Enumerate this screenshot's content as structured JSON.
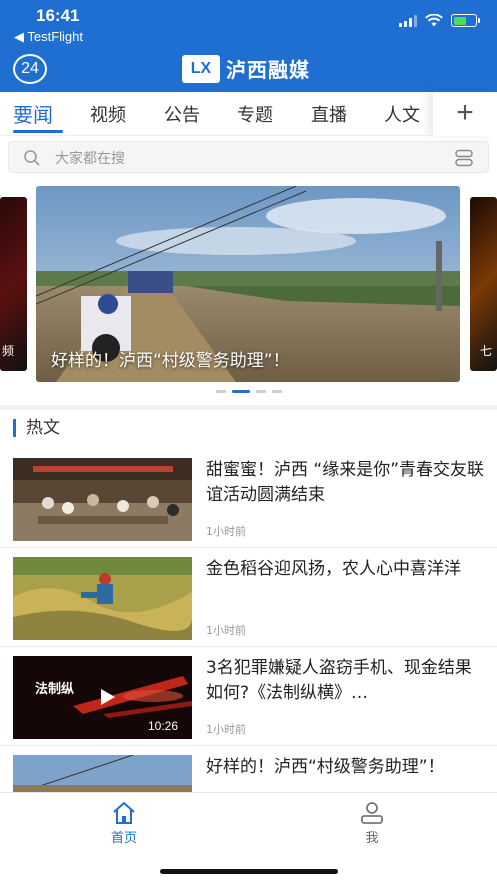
{
  "status": {
    "time": "16:41",
    "back_app": "◀ TestFlight"
  },
  "header": {
    "badge": "24",
    "logo_mark": "LX",
    "logo_text": "泸西融媒"
  },
  "tabs": [
    {
      "label": "要闻",
      "active": true
    },
    {
      "label": "视频"
    },
    {
      "label": "公告"
    },
    {
      "label": "专题"
    },
    {
      "label": "直播"
    },
    {
      "label": "人文"
    }
  ],
  "tabs_add": "+",
  "search": {
    "placeholder": "大家都在搜"
  },
  "banner": {
    "caption": "好样的！泸西“村级警务助理”！",
    "left_caption": "频",
    "right_caption": "七",
    "dot_count": 4,
    "active_dot": 1
  },
  "section": {
    "title": "热文"
  },
  "news": [
    {
      "title": "甜蜜蜜！泸西 “缘来是你”青春交友联谊活动圆满结束",
      "time": "1小时前"
    },
    {
      "title": "金色稻谷迎风扬，农人心中喜洋洋",
      "time": "1小时前"
    },
    {
      "title": "3名犯罪嫌疑人盗窃手机、现金结果如何?《法制纵横》…",
      "time": "1小时前",
      "duration": "10:26",
      "thumb_text": "法制纵"
    },
    {
      "title": "好样的！泸西“村级警务助理”！",
      "time": ""
    }
  ],
  "bottom_nav": [
    {
      "label": "首页",
      "active": true,
      "icon": "home-icon"
    },
    {
      "label": "我",
      "active": false,
      "icon": "user-icon"
    }
  ],
  "colors": {
    "accent": "#1e6fd1"
  }
}
